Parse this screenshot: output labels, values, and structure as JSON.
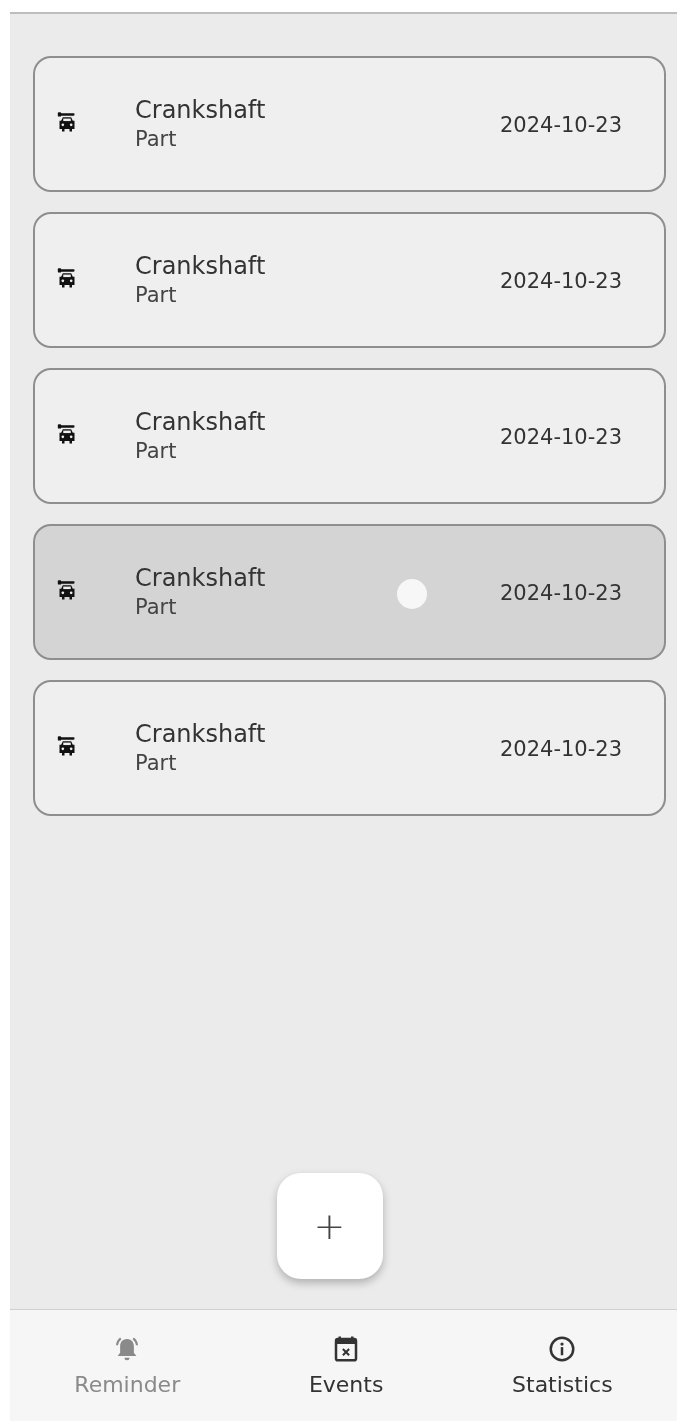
{
  "items": [
    {
      "title": "Crankshaft",
      "subtitle": "Part",
      "date": "2024-10-23",
      "pressed": false
    },
    {
      "title": "Crankshaft",
      "subtitle": "Part",
      "date": "2024-10-23",
      "pressed": false
    },
    {
      "title": "Crankshaft",
      "subtitle": "Part",
      "date": "2024-10-23",
      "pressed": false
    },
    {
      "title": "Crankshaft",
      "subtitle": "Part",
      "date": "2024-10-23",
      "pressed": true
    },
    {
      "title": "Crankshaft",
      "subtitle": "Part",
      "date": "2024-10-23",
      "pressed": false
    }
  ],
  "add_button": {
    "label": "+"
  },
  "nav": [
    {
      "kind": "bell",
      "label": "Reminder",
      "selected": true
    },
    {
      "kind": "calendar",
      "label": "Events",
      "selected": false
    },
    {
      "kind": "info",
      "label": "Statistics",
      "selected": false
    }
  ]
}
